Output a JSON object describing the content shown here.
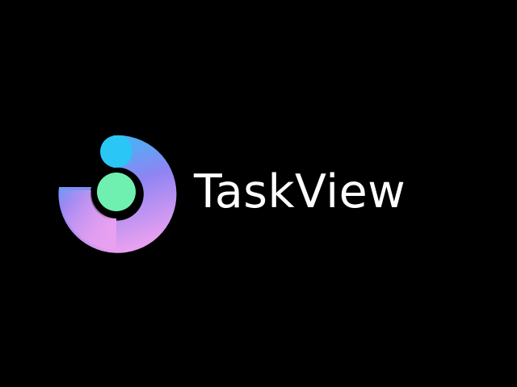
{
  "app": {
    "name": "TaskView",
    "logo_icon": "taskview-logo-icon"
  },
  "colors": {
    "background": "#000000",
    "wordmark": "#ffffff",
    "logo_dot": "#6ff0b0",
    "logo_gradient_top": "#29c6f6",
    "logo_gradient_mid": "#8f84f3",
    "logo_gradient_bottom": "#e8a0f0"
  }
}
